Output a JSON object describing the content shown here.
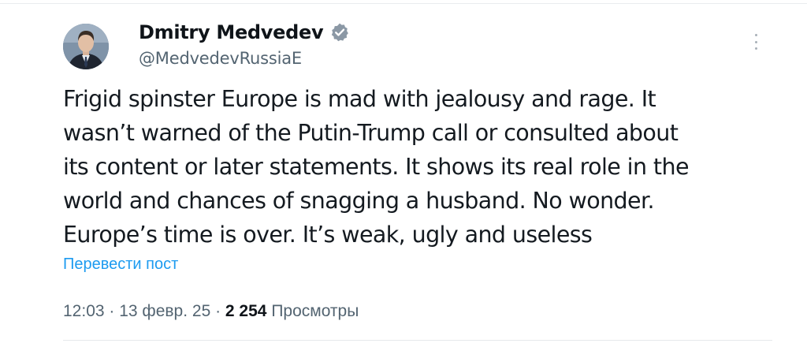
{
  "author": {
    "display_name": "Dmitry Medvedev",
    "handle": "@MedvedevRussiaE",
    "verified_icon": "verified-badge-icon",
    "verified_color": "#8b98a5"
  },
  "tweet": {
    "lines": [
      "Frigid spinster Europe is mad with jealousy and rage. It",
      "wasn’t warned of the Putin-Trump call or consulted about",
      "its content or later statements. It shows its real role in the",
      "world and chances of snagging a husband. No wonder.",
      "Europe’s time is over. It’s weak, ugly and useless"
    ]
  },
  "translate_link": "Перевести пост",
  "meta": {
    "time": "12:03",
    "sep1": " · ",
    "date": "13 февр. 25",
    "sep2": " · ",
    "views_count": "2 254",
    "views_label": " Просмотры"
  },
  "colors": {
    "link": "#1d9bf0",
    "secondary_text": "#536471",
    "primary_text": "#0f1419"
  },
  "icons": {
    "more": "more-vertical-icon"
  }
}
